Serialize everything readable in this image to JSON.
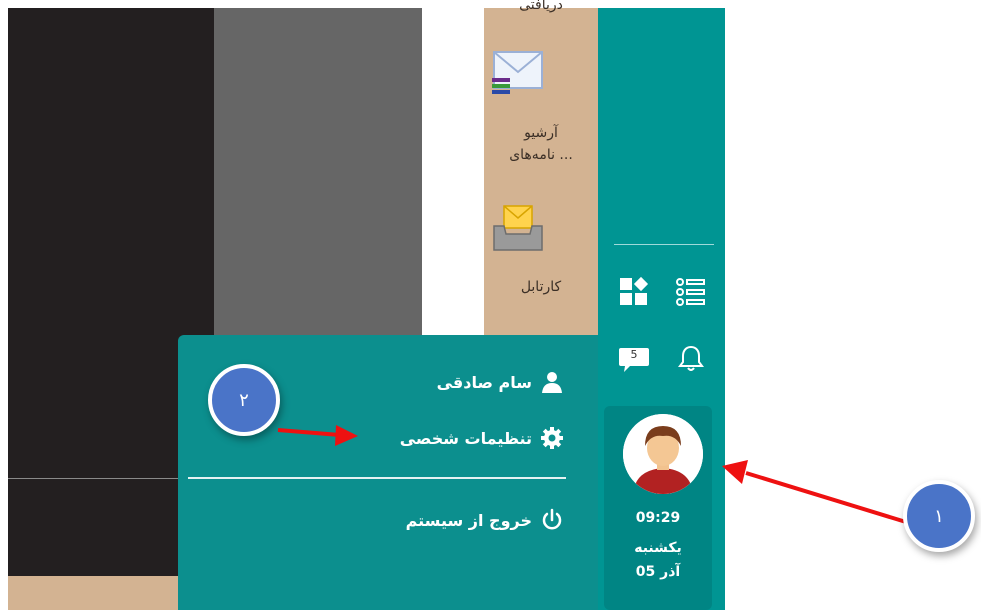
{
  "desktop": {
    "top_label": "دریافتی",
    "icons": [
      {
        "label_line1": "آرشیو",
        "label_line2": "نامه‌های ..."
      },
      {
        "label_line1": "کارتابل",
        "label_line2": ""
      }
    ]
  },
  "sidebar": {
    "notification_count": "5",
    "clock": {
      "time": "09:29",
      "weekday": "یکشنبه",
      "date": "05 آذر"
    }
  },
  "user_menu": {
    "user_name": "سام صادقی",
    "settings_label": "تنظیمات شخصی",
    "logout_label": "خروج از سیستم"
  },
  "annotations": {
    "callout_1": "١",
    "callout_2": "٢"
  },
  "colors": {
    "teal": "#009593",
    "menu_teal": "#0c8f8e",
    "callout": "#4a74c8",
    "arrow": "#ee1111"
  }
}
